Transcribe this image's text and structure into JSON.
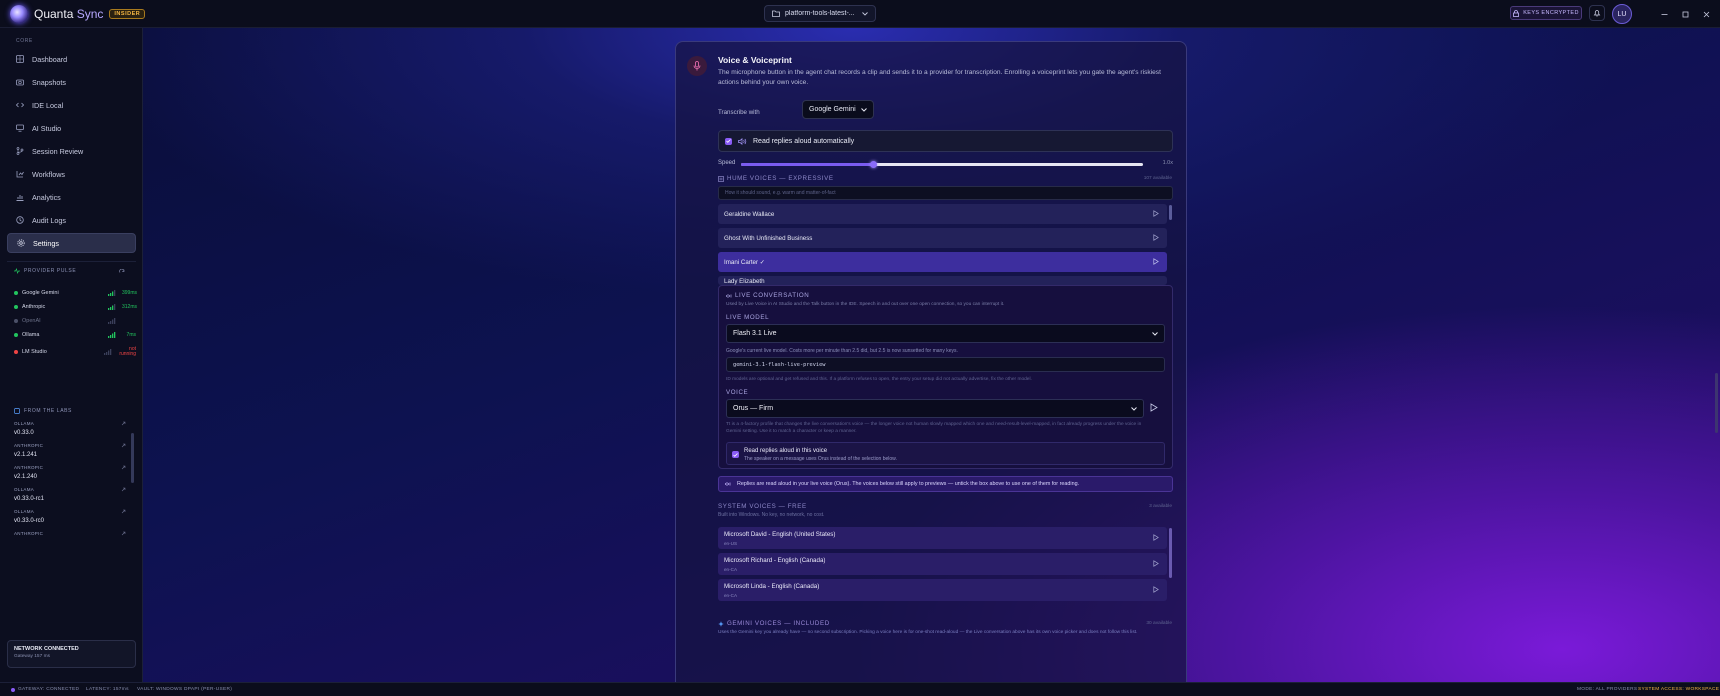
{
  "titlebar": {
    "app_name_a": "Quanta",
    "app_name_b": "Sync",
    "badge": "INSIDER",
    "workspace": "platform-tools-latest-...",
    "keys": "KEYS ENCRYPTED",
    "avatar": "LU",
    "icons": [
      "folder-icon",
      "chevron-down-icon",
      "lock-icon",
      "bell-icon",
      "minimize-icon",
      "maximize-icon",
      "close-icon"
    ]
  },
  "sidebar": {
    "section": "CORE",
    "items": [
      {
        "label": "Dashboard",
        "icon": "grid-icon"
      },
      {
        "label": "Snapshots",
        "icon": "camera-icon"
      },
      {
        "label": "IDE Local",
        "icon": "code-icon"
      },
      {
        "label": "AI Studio",
        "icon": "monitor-icon"
      },
      {
        "label": "Session Review",
        "icon": "branch-icon"
      },
      {
        "label": "Workflows",
        "icon": "flow-icon"
      },
      {
        "label": "Analytics",
        "icon": "chart-icon"
      },
      {
        "label": "Audit Logs",
        "icon": "clock-icon"
      },
      {
        "label": "Settings",
        "icon": "gear-icon"
      }
    ],
    "pulse": {
      "title": "PROVIDER PULSE",
      "providers": [
        {
          "name": "Google Gemini",
          "latency": "399ms",
          "color": "#22c55e",
          "bars": 3
        },
        {
          "name": "Anthropic",
          "latency": "312ms",
          "color": "#22c55e",
          "bars": 3
        },
        {
          "name": "OpenAI",
          "latency": "",
          "color": "#6b7280",
          "bars": 0
        },
        {
          "name": "Ollama",
          "latency": "7ms",
          "color": "#22c55e",
          "bars": 4
        },
        {
          "name": "LM Studio",
          "latency": "not running",
          "color": "#ef4444",
          "bars": 0
        }
      ]
    },
    "labs": {
      "title": "FROM THE LABS",
      "items": [
        {
          "vendor": "OLLAMA",
          "version": "v0.33.0"
        },
        {
          "vendor": "ANTHROPIC",
          "version": "v2.1.241"
        },
        {
          "vendor": "ANTHROPIC",
          "version": "v2.1.240"
        },
        {
          "vendor": "OLLAMA",
          "version": "v0.33.0-rc1"
        },
        {
          "vendor": "OLLAMA",
          "version": "v0.33.0-rc0"
        },
        {
          "vendor": "ANTHROPIC",
          "version": ""
        }
      ]
    },
    "network": {
      "title": "NETWORK CONNECTED",
      "sub": "Gateway 157 ms"
    }
  },
  "voice": {
    "title": "Voice & Voiceprint",
    "description": "The microphone button in the agent chat records a clip and sends it to a provider for transcription. Enrolling a voiceprint lets you gate the agent's riskiest actions behind your own voice.",
    "transcribe_label": "Transcribe with",
    "transcribe_value": "Google Gemini",
    "auto_read_label": "Read replies aloud automatically",
    "auto_read_checked": true,
    "speed_label": "Speed",
    "speed_value": "1.0x",
    "speed_fraction": 0.33,
    "hume": {
      "title": "HUME VOICES — EXPRESSIVE",
      "count": "107 available",
      "search_placeholder": "How it should sound, e.g. warm and matter-of-fact",
      "voices": [
        {
          "name": "Geraldine Wallace",
          "selected": false
        },
        {
          "name": "Ghost With Unfinished Business",
          "selected": false
        },
        {
          "name": "Imani Carter ✓",
          "selected": true
        },
        {
          "name": "Lady Elizabeth",
          "selected": false
        }
      ]
    },
    "live": {
      "title": "LIVE CONVERSATION",
      "description": "Used by Live Voice in AI Studio and the Talk button in the IDE. Speech in and out over one open connection, so you can interrupt it.",
      "model_label": "LIVE MODEL",
      "model_value": "Flash 3.1 Live",
      "model_note": "Google's current live model. Costs more per minute than 2.5 did, but 2.5 is now sunsetted for many keys.",
      "model_id": "gemini-3.1-flash-live-preview",
      "model_id_note": "ID models are optional and get refused and this. If a platform refuses to open, the entry your setup did not actually advertise, fix the other model.",
      "voice_label": "VOICE",
      "voice_value": "Orus — Firm",
      "voice_note": "Tt is a 4-factory profile that changes the live conversation's voice — the longer voice not human slowly mapped which one and need-result-level-mapped, in fact already progress under the voice in Gemini setting. Use it to match a character or keep a manner.",
      "read_title": "Read replies aloud in this voice",
      "read_sub": "The speaker on a message uses Orus instead of the selection below.",
      "read_checked": true
    },
    "info": "Replies are read aloud in your live voice (Orus). The voices below still apply to previews — untick the box above to use one of them for reading.",
    "system": {
      "title": "SYSTEM VOICES — FREE",
      "count": "3 available",
      "description": "Built into Windows. No key, no network, no cost.",
      "voices": [
        {
          "name": "Microsoft David - English (United States)",
          "locale": "en-US"
        },
        {
          "name": "Microsoft Richard - English (Canada)",
          "locale": "en-CA"
        },
        {
          "name": "Microsoft Linda - English (Canada)",
          "locale": "en-CA"
        }
      ]
    },
    "gemini": {
      "title": "GEMINI VOICES — INCLUDED",
      "count": "30 available",
      "description": "Uses the Gemini key you already have — no second subscription. Picking a voice here is for one-shot read-aloud — the Live conversation above has its own voice picker and does not follow this list."
    }
  },
  "statusbar": {
    "gateway": "GATEWAY: CONNECTED",
    "latency": "LATENCY: 157ms",
    "vault": "VAULT: WINDOWS DPAPI (PER-USER)",
    "mode": "MODE: ALL PROVIDERS",
    "access": "SYSTEM ACCESS: WORKSPACE"
  },
  "colors": {
    "accent": "#8a5cf6",
    "ok": "#22c55e",
    "error": "#ef4444",
    "warning": "#f5b642"
  }
}
